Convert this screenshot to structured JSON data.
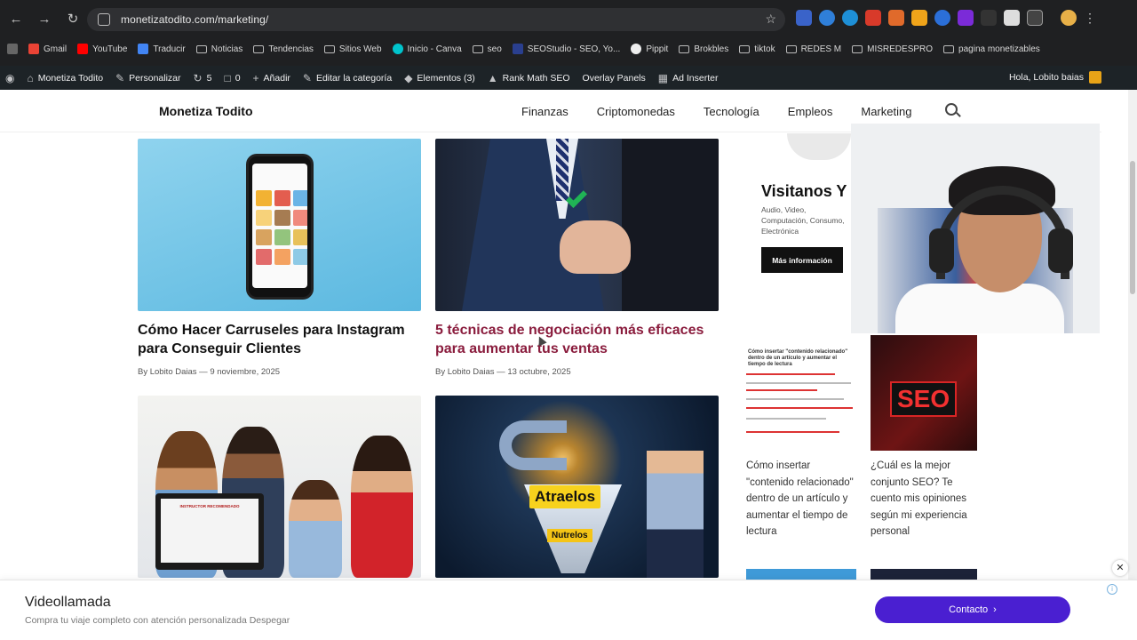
{
  "browser": {
    "url": "monetizatodito.com/marketing/",
    "bookmarks": [
      "Gmail",
      "YouTube",
      "Traducir",
      "Noticias",
      "Tendencias",
      "Sitios Web",
      "Inicio - Canva",
      "seo",
      "SEOStudio - SEO, Yo...",
      "Pippit",
      "Brokbles",
      "tiktok",
      "REDES M",
      "MISREDESPRO",
      "pagina monetizables"
    ]
  },
  "wp_admin_bar": {
    "items": [
      "Monetiza Todito",
      "Personalizar",
      "5",
      "0",
      "Añadir",
      "Editar la categoría",
      "Elementos (3)",
      "Rank Math SEO",
      "Overlay Panels",
      "Ad Inserter"
    ],
    "greeting": "Hola, Lobito baias"
  },
  "site": {
    "brand": "Monetiza Todito",
    "menu": [
      "Finanzas",
      "Criptomonedas",
      "Tecnología",
      "Empleos",
      "Marketing"
    ]
  },
  "posts": [
    {
      "title": "Cómo Hacer Carruseles para Instagram para Conseguir Clientes",
      "meta": "By Lobito Daias — 9 noviembre, 2025"
    },
    {
      "title": "5 técnicas de negociación más eficaces para aumentar tus ventas",
      "meta": "By Lobito Daias — 13 octubre, 2025"
    }
  ],
  "post_images": {
    "img3_banner": "INSTRUCTOR RECOMENDADO",
    "img4_label1": "Atraelos",
    "img4_label2": "Nutrelos"
  },
  "sidebar_ad": {
    "title": "Visitanos Y",
    "subtitle": "Audio, Video, Computación, Consumo, Electrónica",
    "button": "Más información"
  },
  "sidebar_posts": [
    {
      "thumb_caption": "Cómo insertar \"contenido relacionado\" dentro de un artículo y aumentar el tiempo de lectura",
      "title": "Cómo insertar \"contenido relacionado\" dentro de un artículo y aumentar el tiempo de lectura"
    },
    {
      "thumb_label": "SEO",
      "title": "¿Cuál es la mejor conjunto SEO? Te cuento mis opiniones según mi experiencia personal"
    }
  ],
  "bottom_ad": {
    "title": "Videollamada",
    "subtitle": "Compra tu viaje completo con atención personalizada Despegar",
    "button": "Contacto"
  },
  "colors": {
    "accent_title": "#8a1c3d",
    "ad_button": "#4a1fd1",
    "wp_bar": "#1d2327"
  }
}
